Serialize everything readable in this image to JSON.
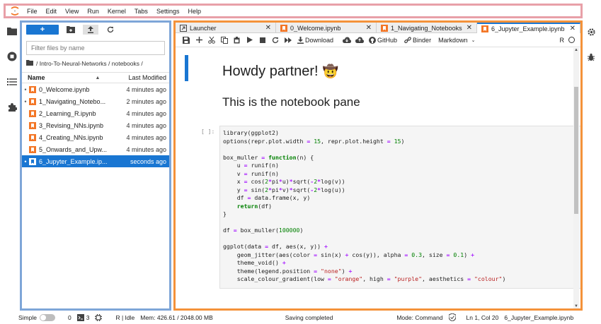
{
  "menubar": {
    "items": [
      "File",
      "Edit",
      "View",
      "Run",
      "Kernel",
      "Tabs",
      "Settings",
      "Help"
    ]
  },
  "filebrowser": {
    "new_label": "+",
    "search_placeholder": "Filter files by name",
    "path": "/ Intro-To-Neural-Networks / notebooks /",
    "col_name": "Name",
    "col_modified": "Last Modified",
    "files": [
      {
        "running": "•",
        "name": "0_Welcome.ipynb",
        "modified": "4 minutes ago"
      },
      {
        "running": "•",
        "name": "1_Navigating_Notebo...",
        "modified": "2 minutes ago"
      },
      {
        "running": "",
        "name": "2_Learning_R.ipynb",
        "modified": "4 minutes ago"
      },
      {
        "running": "",
        "name": "3_Revising_NNs.ipynb",
        "modified": "4 minutes ago"
      },
      {
        "running": "",
        "name": "4_Creating_NNs.ipynb",
        "modified": "4 minutes ago"
      },
      {
        "running": "",
        "name": "5_Onwards_and_Upw...",
        "modified": "4 minutes ago"
      },
      {
        "running": "•",
        "name": "6_Jupyter_Example.ip...",
        "modified": "seconds ago"
      }
    ]
  },
  "tabs": [
    {
      "label": "Launcher",
      "close": "✕"
    },
    {
      "label": "0_Welcome.ipynb",
      "close": "✕"
    },
    {
      "label": "1_Navigating_Notebooks.ip",
      "close": "✕"
    },
    {
      "label": "6_Jupyter_Example.ipynb",
      "close": "✕"
    }
  ],
  "toolbar": {
    "download": "Download",
    "github": "GitHub",
    "binder": "Binder",
    "celltype": "Markdown",
    "kernel": "R"
  },
  "notebook": {
    "heading1": "Howdy partner!",
    "heading1_emoji": "🤠",
    "heading2": "This is the notebook pane",
    "prompt": "[ ]:"
  },
  "statusbar": {
    "simple": "Simple",
    "terminals": "0",
    "kernels": "3",
    "kernel_status": "R | Idle",
    "memory": "Mem: 426.61 / 2048.00 MB",
    "message": "Saving completed",
    "mode": "Mode: Command",
    "position": "Ln 1, Col 20",
    "filename": "6_Jupyter_Example.ipynb"
  },
  "colors": {
    "accent": "#1976d2",
    "menubar_outline": "#e8a0a8",
    "filepanel_outline": "#7ea6d8",
    "mainpanel_outline": "#f4923a",
    "notebook_icon": "#f37626"
  },
  "icons": [
    "jupyter-logo-icon",
    "folder-icon",
    "stop-circle-icon",
    "list-icon",
    "puzzle-icon",
    "gear-icon",
    "bug-icon"
  ]
}
